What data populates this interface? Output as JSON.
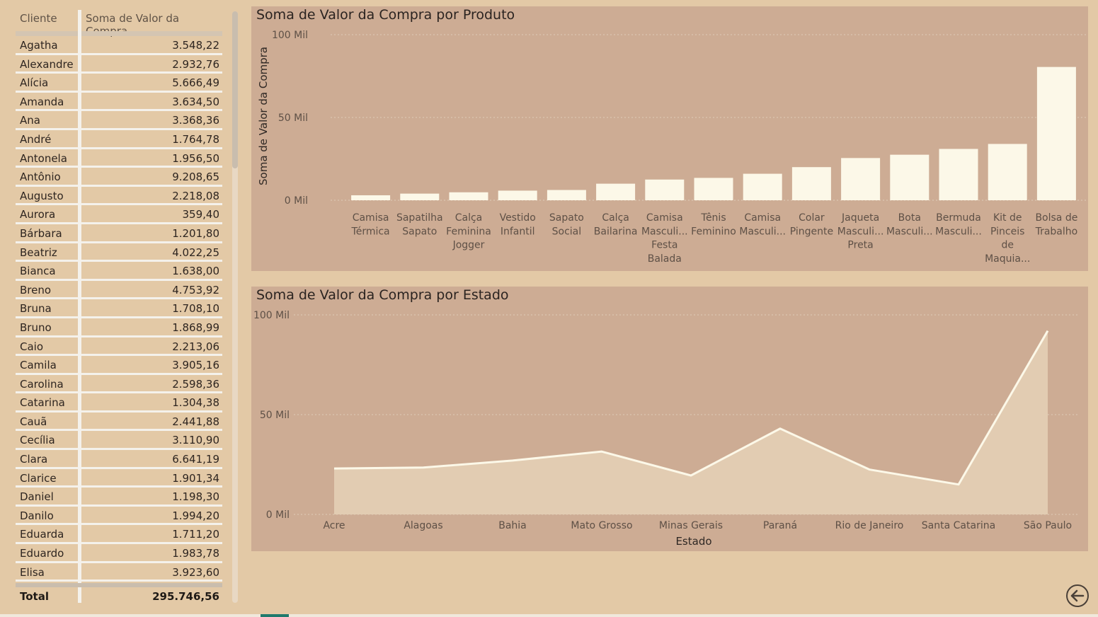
{
  "table": {
    "col_cliente": "Cliente",
    "col_valor": "Soma de Valor da Compra",
    "rows": [
      {
        "name": "Agatha",
        "value": "3.548,22"
      },
      {
        "name": "Alexandre",
        "value": "2.932,76"
      },
      {
        "name": "Alícia",
        "value": "5.666,49"
      },
      {
        "name": "Amanda",
        "value": "3.634,50"
      },
      {
        "name": "Ana",
        "value": "3.368,36"
      },
      {
        "name": "André",
        "value": "1.764,78"
      },
      {
        "name": "Antonela",
        "value": "1.956,50"
      },
      {
        "name": "Antônio",
        "value": "9.208,65"
      },
      {
        "name": "Augusto",
        "value": "2.218,08"
      },
      {
        "name": "Aurora",
        "value": "359,40"
      },
      {
        "name": "Bárbara",
        "value": "1.201,80"
      },
      {
        "name": "Beatriz",
        "value": "4.022,25"
      },
      {
        "name": "Bianca",
        "value": "1.638,00"
      },
      {
        "name": "Breno",
        "value": "4.753,92"
      },
      {
        "name": "Bruna",
        "value": "1.708,10"
      },
      {
        "name": "Bruno",
        "value": "1.868,99"
      },
      {
        "name": "Caio",
        "value": "2.213,06"
      },
      {
        "name": "Camila",
        "value": "3.905,16"
      },
      {
        "name": "Carolina",
        "value": "2.598,36"
      },
      {
        "name": "Catarina",
        "value": "1.304,38"
      },
      {
        "name": "Cauã",
        "value": "2.441,88"
      },
      {
        "name": "Cecília",
        "value": "3.110,90"
      },
      {
        "name": "Clara",
        "value": "6.641,19"
      },
      {
        "name": "Clarice",
        "value": "1.901,34"
      },
      {
        "name": "Daniel",
        "value": "1.198,30"
      },
      {
        "name": "Danilo",
        "value": "1.994,20"
      },
      {
        "name": "Eduarda",
        "value": "1.711,20"
      },
      {
        "name": "Eduardo",
        "value": "1.983,78"
      },
      {
        "name": "Elisa",
        "value": "3.923,60"
      }
    ],
    "total_label": "Total",
    "total_value": "295.746,56"
  },
  "chart_data": [
    {
      "type": "bar",
      "title": "Soma de Valor da Compra por Produto",
      "xlabel": "",
      "ylabel": "Soma de Valor da Compra",
      "ylim": [
        0,
        100000
      ],
      "y_ticks": [
        "0 Mil",
        "50 Mil",
        "100 Mil"
      ],
      "categories": [
        [
          "Camisa",
          "Térmica"
        ],
        [
          "Sapatilha",
          "Sapato"
        ],
        [
          "Calça",
          "Feminina",
          "Jogger"
        ],
        [
          "Vestido",
          "Infantil"
        ],
        [
          "Sapato",
          "Social"
        ],
        [
          "Calça",
          "Bailarina"
        ],
        [
          "Camisa",
          "Masculi...",
          "Festa",
          "Balada"
        ],
        [
          "Tênis",
          "Feminino"
        ],
        [
          "Camisa",
          "Masculi..."
        ],
        [
          "Colar",
          "Pingente"
        ],
        [
          "Jaqueta",
          "Masculi...",
          "Preta"
        ],
        [
          "Bota",
          "Masculi..."
        ],
        [
          "Bermuda",
          "Masculi..."
        ],
        [
          "Kit de",
          "Pinceis",
          "de",
          "Maquia..."
        ],
        [
          "Bolsa de",
          "Trabalho"
        ]
      ],
      "values": [
        3000,
        4000,
        4800,
        5800,
        6200,
        10000,
        12500,
        13500,
        16000,
        20000,
        25500,
        27500,
        31000,
        34000,
        80500
      ],
      "bar_color": "#fcf8e8",
      "grid": true
    },
    {
      "type": "area",
      "title": "Soma de Valor da Compra por Estado",
      "xlabel": "Estado",
      "ylabel": "",
      "ylim": [
        0,
        100000
      ],
      "y_ticks": [
        "0 Mil",
        "50 Mil",
        "100 Mil"
      ],
      "categories": [
        "Acre",
        "Alagoas",
        "Bahia",
        "Mato Grosso",
        "Minas Gerais",
        "Paraná",
        "Rio de Janeiro",
        "Santa Catarina",
        "São Paulo"
      ],
      "values": [
        23000,
        23500,
        27000,
        31500,
        19500,
        43000,
        22500,
        15000,
        92000
      ],
      "line_color": "#fcf8e8",
      "fill_color": "#e2ccb2",
      "grid": true
    }
  ],
  "colors": {
    "background": "#e3c9a6",
    "panel": "#cdac94",
    "bar": "#fcf8e8"
  },
  "back_button": {
    "icon": "arrow-left-circle-icon"
  }
}
